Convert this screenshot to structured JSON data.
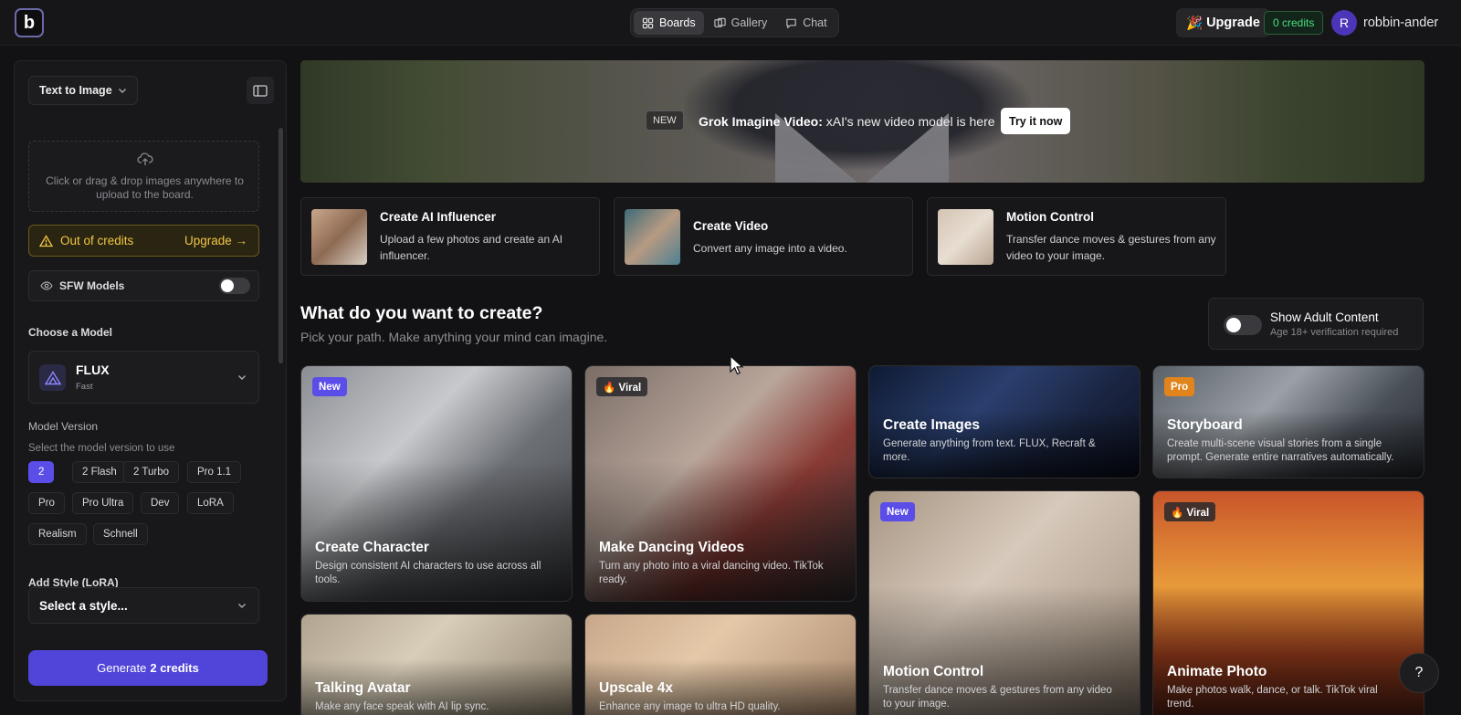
{
  "header": {
    "nav": [
      {
        "label": "Boards",
        "icon": "boards-icon"
      },
      {
        "label": "Gallery",
        "icon": "gallery-icon"
      },
      {
        "label": "Chat",
        "icon": "chat-icon"
      }
    ],
    "upgrade_label": "Upgrade",
    "upgrade_emoji": "🎉",
    "credits": "0 credits",
    "avatar_initial": "R",
    "username": "robbin-ander"
  },
  "sidebar": {
    "mode": "Text to Image",
    "dropzone_text": "Click or drag & drop images anywhere to upload to the board.",
    "out_of_credits": "Out of credits",
    "upgrade_link": "Upgrade →",
    "sfw_label": "SFW Models",
    "sfw_enabled": false,
    "choose_model_title": "Choose a Model",
    "model": {
      "name": "FLUX",
      "sub": "Fast"
    },
    "model_version_title": "Model Version",
    "model_version_hint": "Select the model version to use",
    "versions": [
      "2",
      "2 Flash",
      "2 Turbo",
      "Pro 1.1",
      "Pro",
      "Pro Ultra",
      "Dev",
      "LoRA",
      "Realism",
      "Schnell"
    ],
    "selected_version": "2",
    "style_title": "Add Style (LoRA)",
    "style_placeholder": "Select a style...",
    "generate_label": "Generate",
    "generate_credits": "2 credits"
  },
  "banner": {
    "tag": "NEW",
    "title": "Grok Imagine Video:",
    "text": "xAI's new video model is here",
    "button": "Try it now"
  },
  "features": [
    {
      "title": "Create AI Influencer",
      "desc": "Upload a few photos and create an AI influencer."
    },
    {
      "title": "Create Video",
      "desc": "Convert any image into a video."
    },
    {
      "title": "Motion Control",
      "desc": "Transfer dance moves & gestures from any video to your image."
    }
  ],
  "section": {
    "title": "What do you want to create?",
    "subtitle": "Pick your path. Make anything your mind can imagine."
  },
  "adult": {
    "title": "Show Adult Content",
    "sub": "Age 18+ verification required",
    "enabled": false
  },
  "cards": [
    {
      "badge": "New",
      "title": "Create Character",
      "desc": "Design consistent AI characters to use across all tools."
    },
    {
      "badge": "🔥 Viral",
      "title": "Make Dancing Videos",
      "desc": "Turn any photo into a viral dancing video. TikTok ready."
    },
    {
      "badge": "",
      "title": "Create Images",
      "desc": "Generate anything from text. FLUX, Recraft & more."
    },
    {
      "badge": "Pro",
      "title": "Storyboard",
      "desc": "Create multi-scene visual stories from a single prompt. Generate entire narratives automatically."
    },
    {
      "badge": "New",
      "title": "Motion Control",
      "desc": "Transfer dance moves & gestures from any video to your image."
    },
    {
      "badge": "🔥 Viral",
      "title": "Animate Photo",
      "desc": "Make photos walk, dance, or talk. TikTok viral trend."
    },
    {
      "badge": "",
      "title": "Talking Avatar",
      "desc": "Make any face speak with AI lip sync."
    },
    {
      "badge": "",
      "title": "Upscale 4x",
      "desc": "Enhance any image to ultra HD quality."
    }
  ],
  "help_label": "?",
  "colors": {
    "accent": "#5b4de8",
    "warning": "#f2c744",
    "success": "#4ade80",
    "background": "#121214"
  }
}
